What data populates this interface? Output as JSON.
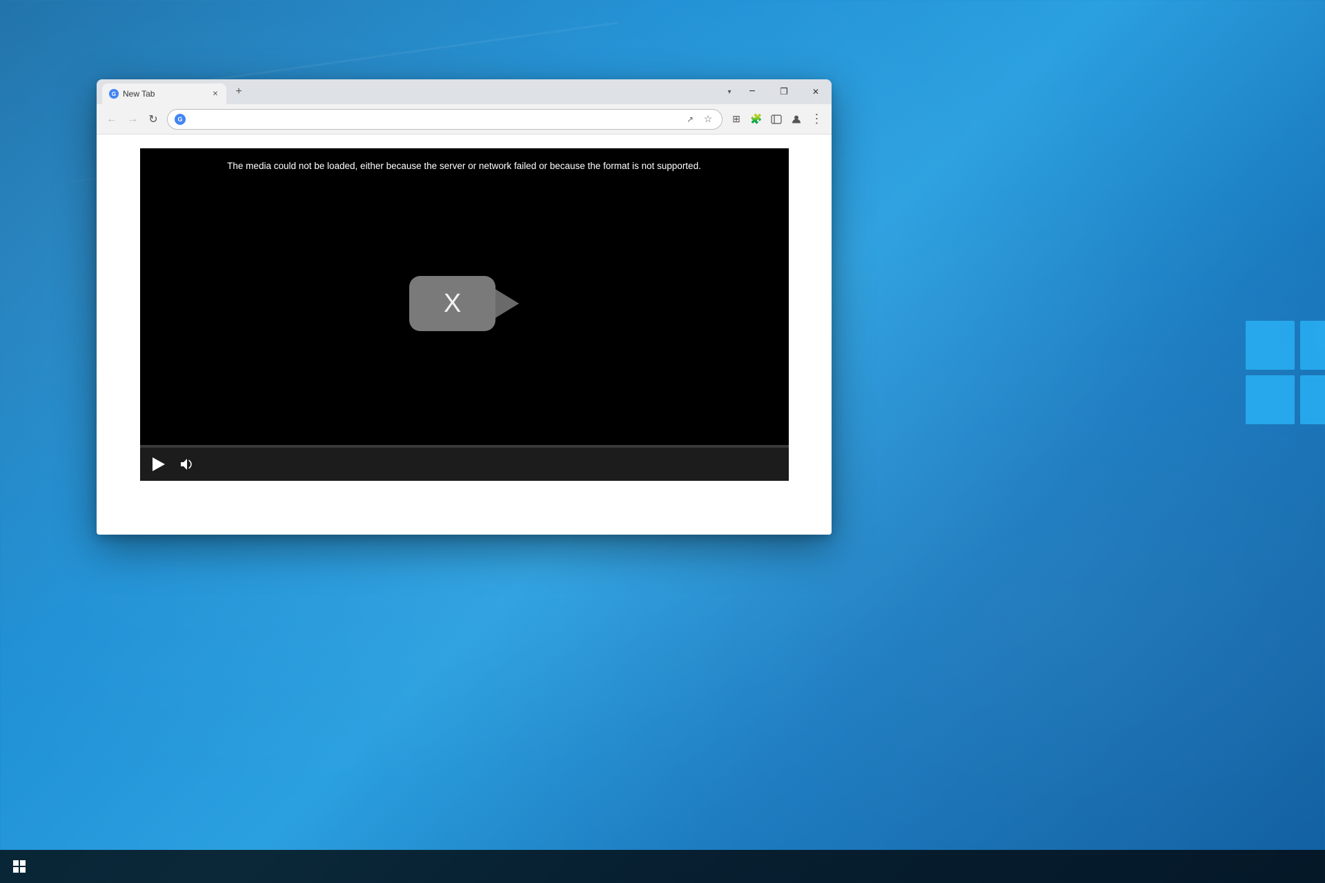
{
  "desktop": {
    "background_color_start": "#1a6fa8",
    "background_color_end": "#0d5c9e"
  },
  "taskbar": {
    "start_label": "Start"
  },
  "browser": {
    "tab": {
      "title": "New Tab",
      "favicon_letter": "G"
    },
    "new_tab_btn_label": "+",
    "controls": {
      "minimize": "−",
      "maximize": "❐",
      "close": "✕"
    },
    "navbar": {
      "back_label": "←",
      "forward_label": "→",
      "refresh_label": "↻",
      "address_placeholder": "",
      "address_value": "",
      "google_letter": "G",
      "bookmark_icon": "☆",
      "share_icon": "↗",
      "extensions_icon": "⊞",
      "profile_icon": "👤",
      "menu_icon": "⋮",
      "puzzle_icon": "🧩"
    }
  },
  "video_player": {
    "error_message": "The media could not be loaded, either because the server or network failed or because the format is not supported.",
    "broken_icon_label": "X",
    "controls": {
      "play_label": "Play",
      "volume_label": "Volume"
    }
  }
}
